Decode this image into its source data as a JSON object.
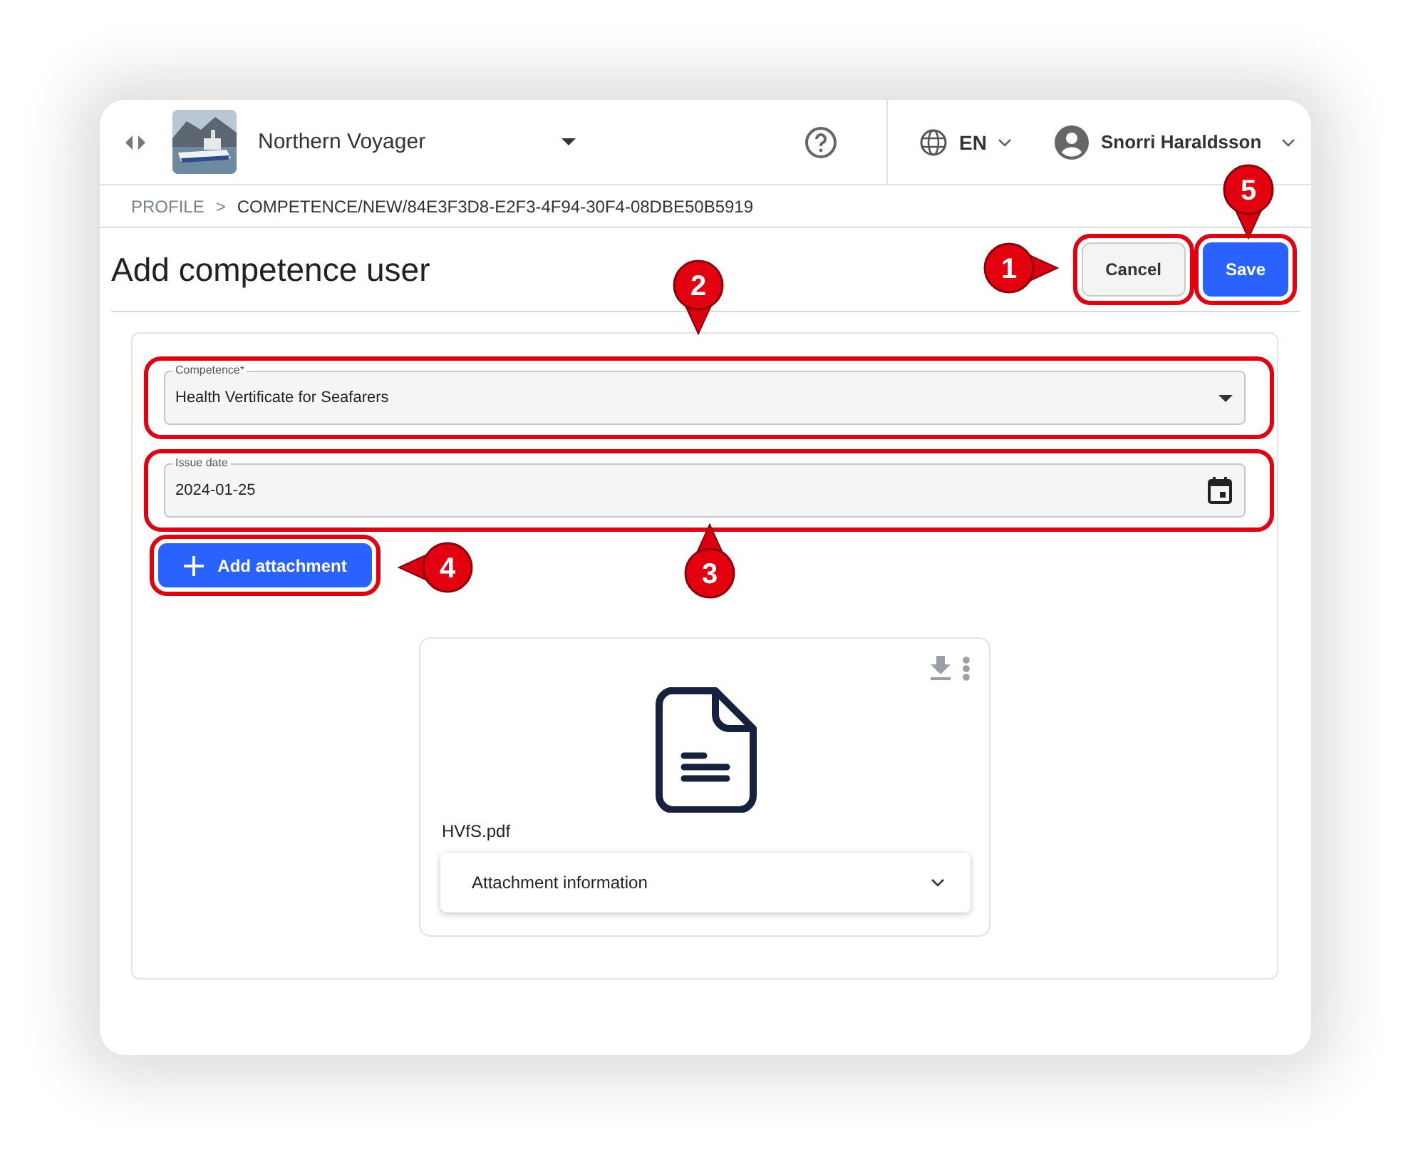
{
  "header": {
    "vessel_name": "Northern Voyager",
    "language": "EN",
    "user_name": "Snorri Haraldsson"
  },
  "breadcrumb": [
    {
      "label": "PROFILE",
      "kind": "link"
    },
    {
      "label": ">",
      "kind": "separator"
    },
    {
      "label": "COMPETENCE/NEW/84E3F3D8-E2F3-4F94-30F4-08DBE50B5919",
      "kind": "current"
    }
  ],
  "page": {
    "title": "Add competence user",
    "buttons": [
      {
        "label": "Cancel",
        "kind": "secondary",
        "highlighted": true
      },
      {
        "label": "Save",
        "kind": "primary",
        "highlighted": true
      }
    ]
  },
  "form": {
    "fields": [
      {
        "kind": "select",
        "label": "Competence*",
        "value": "Health Vertificate for Seafarers",
        "highlighted": true
      },
      {
        "kind": "date",
        "label": "Issue date",
        "value": "2024-01-25",
        "highlighted": true
      }
    ],
    "add_button": {
      "label": "Add attachment",
      "highlighted": true
    }
  },
  "attachments": [
    {
      "file_name": "HVfS.pdf",
      "accordion": {
        "label": "Attachment information",
        "expanded": false
      }
    }
  ],
  "callouts": [
    {
      "number": "1",
      "kind": "right"
    },
    {
      "number": "2",
      "kind": "down"
    },
    {
      "number": "3",
      "kind": "up"
    },
    {
      "number": "4",
      "kind": "left"
    },
    {
      "number": "5",
      "kind": "down"
    }
  ]
}
